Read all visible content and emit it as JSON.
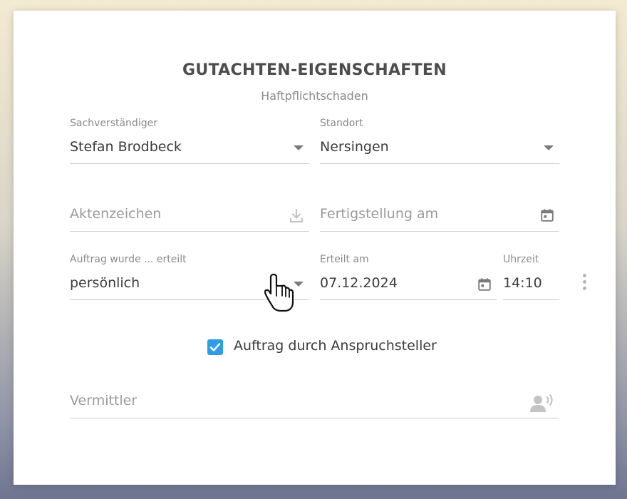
{
  "header": {
    "title": "GUTACHTEN-EIGENSCHAFTEN",
    "subtitle": "Haftpflichtschaden"
  },
  "fields": {
    "sachverstaendiger": {
      "label": "Sachverständiger",
      "value": "Stefan Brodbeck"
    },
    "standort": {
      "label": "Standort",
      "value": "Nersingen"
    },
    "aktenzeichen": {
      "placeholder": "Aktenzeichen",
      "icon": "download-icon"
    },
    "fertigstellung": {
      "placeholder": "Fertigstellung am",
      "icon": "calendar-icon"
    },
    "auftrag": {
      "label": "Auftrag wurde ... erteilt",
      "value": "persönlich"
    },
    "erteilt_am": {
      "label": "Erteilt am",
      "value": "07.12.2024",
      "icon": "calendar-icon"
    },
    "uhrzeit": {
      "label": "Uhrzeit",
      "value": "14:10"
    },
    "vermittler": {
      "placeholder": "Vermittler",
      "icon": "person-voice-icon"
    }
  },
  "checkbox": {
    "label": "Auftrag durch Anspruchsteller",
    "checked": true
  },
  "colors": {
    "accent": "#2b9ee6",
    "text": "#3c3c3c",
    "muted": "#8a8a8a"
  }
}
